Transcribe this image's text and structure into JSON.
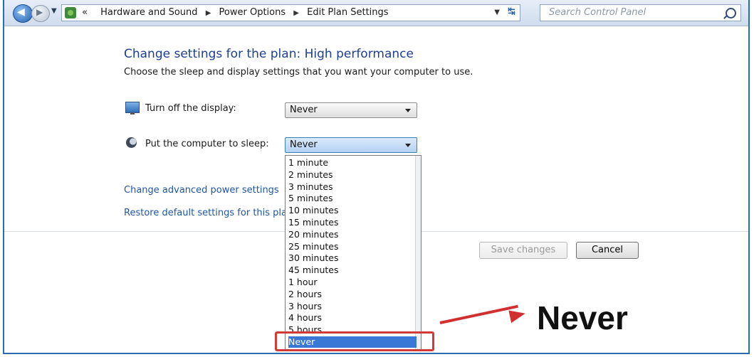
{
  "breadcrumb": [
    "Hardware and Sound",
    "Power Options",
    "Edit Plan Settings"
  ],
  "breadcrumb_prefix": "«",
  "search": {
    "placeholder": "Search Control Panel"
  },
  "page": {
    "title": "Change settings for the plan: High performance",
    "subtitle": "Choose the sleep and display settings that you want your computer to use."
  },
  "display": {
    "label": "Turn off the display:",
    "value": "Never"
  },
  "sleep": {
    "label": "Put the computer to sleep:",
    "value": "Never",
    "options": [
      "1 minute",
      "2 minutes",
      "3 minutes",
      "5 minutes",
      "10 minutes",
      "15 minutes",
      "20 minutes",
      "25 minutes",
      "30 minutes",
      "45 minutes",
      "1 hour",
      "2 hours",
      "3 hours",
      "4 hours",
      "5 hours",
      "Never"
    ],
    "selected_index": 15
  },
  "links": {
    "advanced": "Change advanced power settings",
    "restore": "Restore default settings for this pla"
  },
  "buttons": {
    "save": "Save changes",
    "cancel": "Cancel"
  },
  "annotation": {
    "text": "Never",
    "color": "#d23030"
  }
}
